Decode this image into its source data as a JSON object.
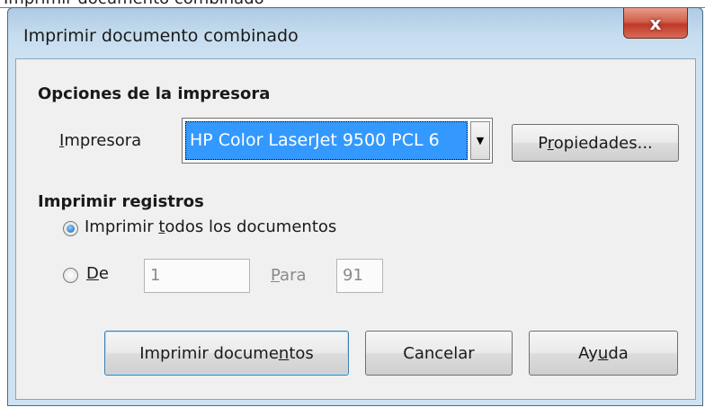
{
  "background_window": {
    "partial_text": "Imprimir documento combinado"
  },
  "dialog": {
    "title": "Imprimir documento combinado",
    "close_label": "x",
    "printer_section": {
      "heading": "Opciones de la impresora",
      "printer_label_pre": "",
      "printer_label_u": "I",
      "printer_label_post": "mpresora",
      "printer_value": "HP Color LaserJet 9500 PCL 6",
      "properties_pre": "P",
      "properties_u": "r",
      "properties_post": "opiedades..."
    },
    "records_section": {
      "heading": "Imprimir registros",
      "all_pre": "Imprimir ",
      "all_u": "t",
      "all_post": "odos los documentos",
      "all_selected": true,
      "from_u": "D",
      "from_post": "e",
      "from_value": "1",
      "to_u": "P",
      "to_post": "ara",
      "to_value": "91"
    },
    "buttons": {
      "print_pre": "Imprimir docume",
      "print_u": "n",
      "print_post": "tos",
      "cancel": "Cancelar",
      "help_pre": "Ay",
      "help_u": "u",
      "help_post": "da"
    }
  }
}
